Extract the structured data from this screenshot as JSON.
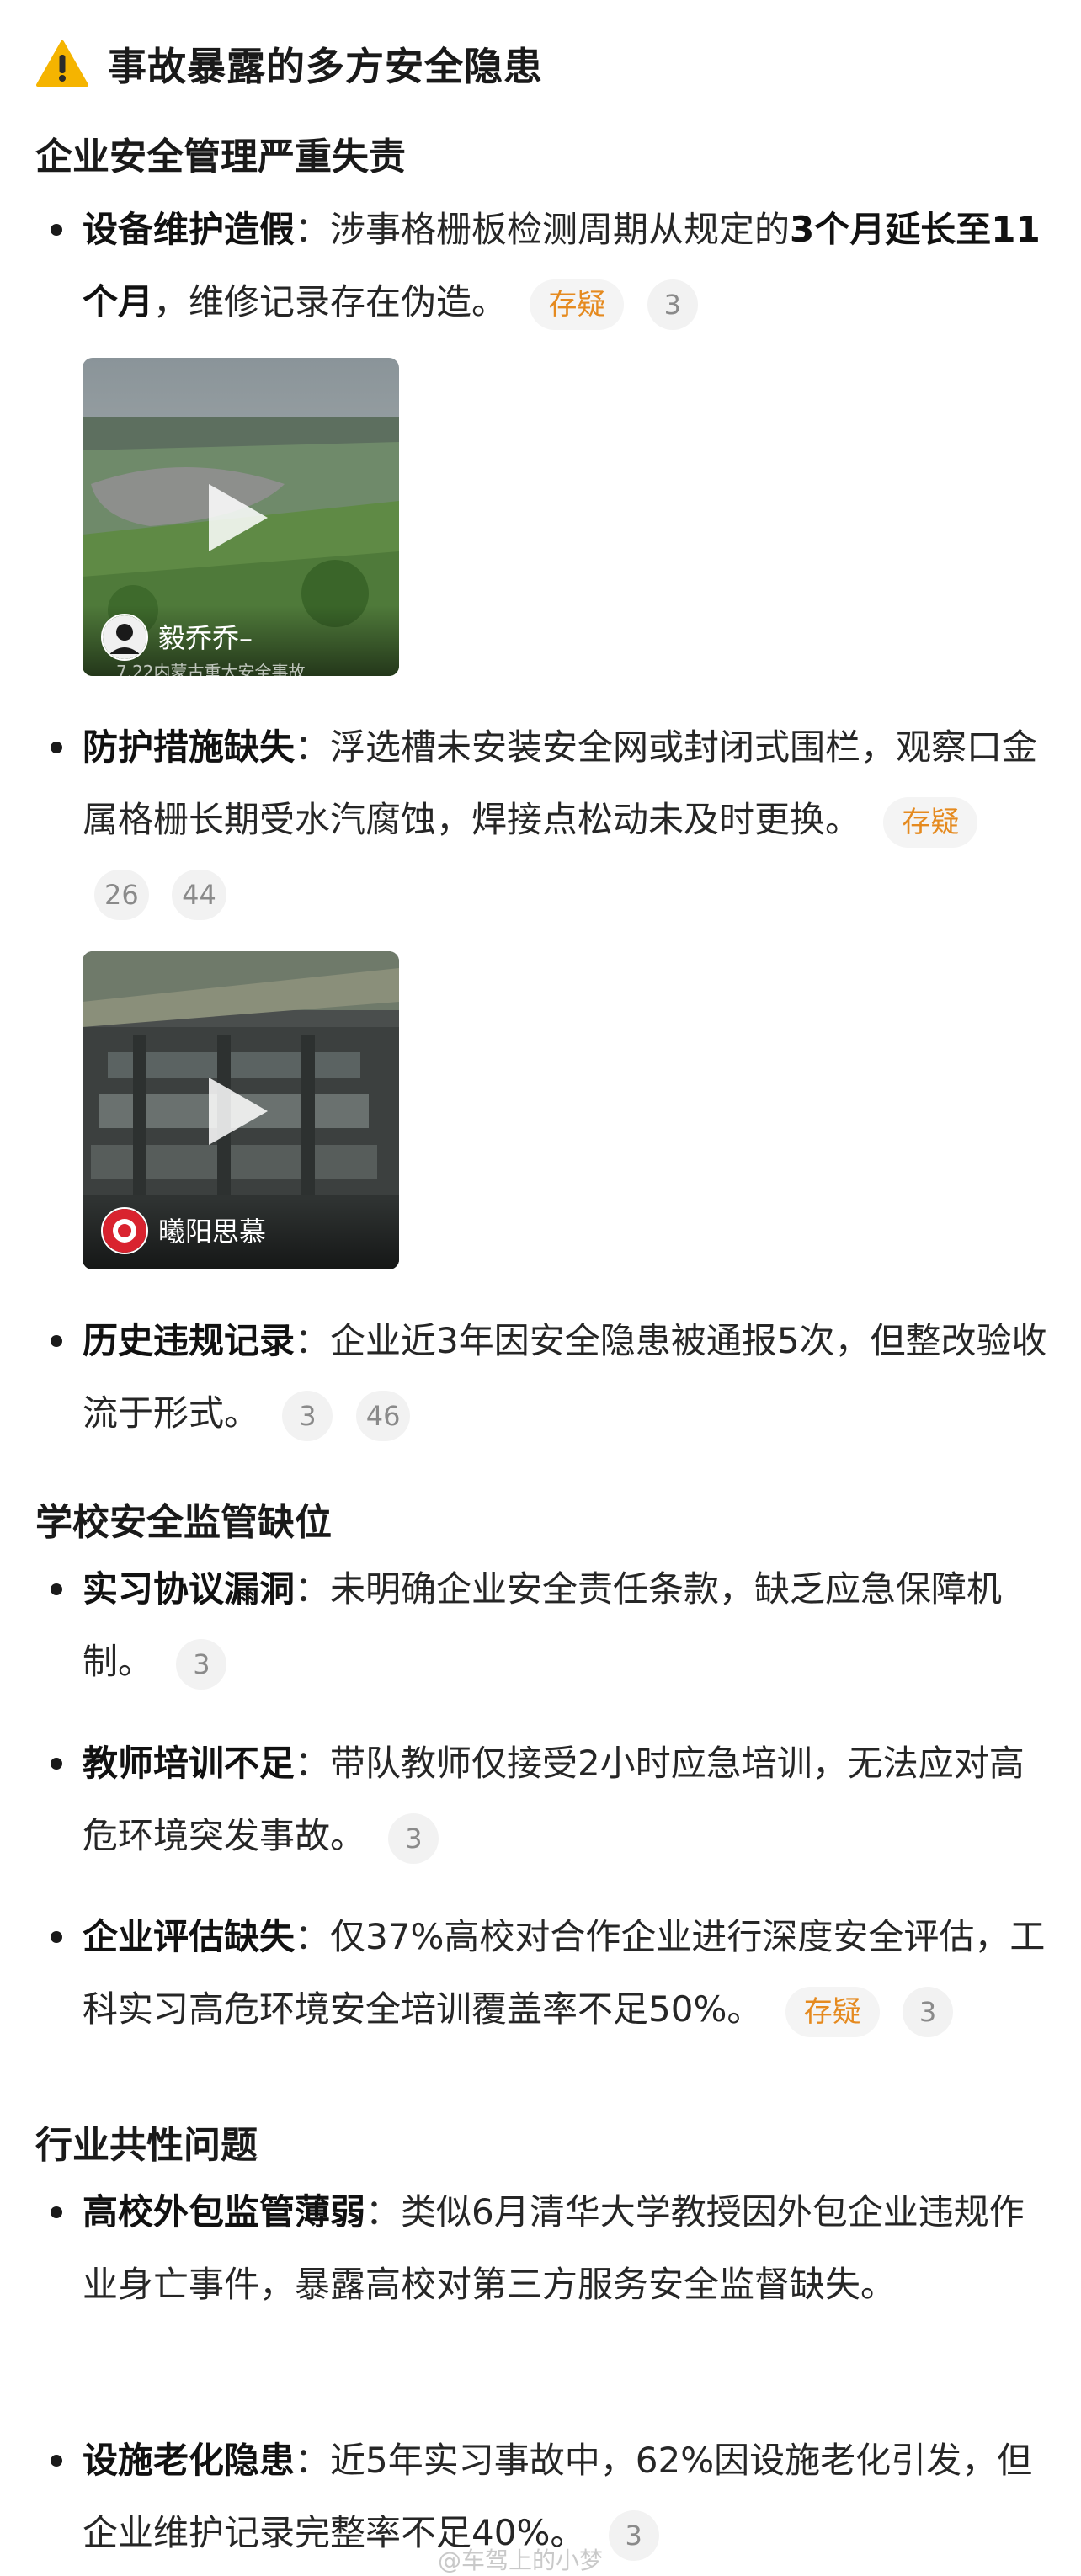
{
  "heading": {
    "icon": "warning-icon",
    "title": "事故暴露的多方安全隐患"
  },
  "sections": [
    {
      "title": "企业安全管理严重失责"
    },
    {
      "title": "学校安全监管缺位"
    },
    {
      "title": "行业共性问题"
    }
  ],
  "items": [
    {
      "label": "设备维护造假",
      "colon": "：",
      "text_a": "涉事格栅板检测周期从规定的",
      "bold_mid": "3个月延长至11个月",
      "text_b": "，维修记录存在伪造。",
      "tag": "存疑",
      "counts": [
        "3"
      ]
    },
    {
      "label": "防护措施缺失",
      "colon": "：",
      "text": "浮选槽未安装安全网或封闭式围栏，观察口金属格栅长期受水汽腐蚀，焊接点松动未及时更换。",
      "tag": "存疑",
      "counts": [
        "26",
        "44"
      ]
    },
    {
      "label": "历史违规记录",
      "colon": "：",
      "text": "企业近3年因安全隐患被通报5次，但整改验收流于形式。",
      "counts": [
        "3",
        "46"
      ]
    },
    {
      "label": "实习协议漏洞",
      "colon": "：",
      "text": "未明确企业安全责任条款，缺乏应急保障机制。",
      "counts": [
        "3"
      ]
    },
    {
      "label": "教师培训不足",
      "colon": "：",
      "text": "带队教师仅接受2小时应急培训，无法应对高危环境突发事故。",
      "counts": [
        "3"
      ]
    },
    {
      "label": "企业评估缺失",
      "colon": "：",
      "text": "仅37%高校对合作企业进行深度安全评估，工科实习高危环境安全培训覆盖率不足50%。",
      "tag": "存疑",
      "counts": [
        "3"
      ]
    },
    {
      "label": "高校外包监管薄弱",
      "colon": "：",
      "text": "类似6月清华大学教授因外包企业违规作业身亡事件，暴露高校对第三方服务安全监督缺失。"
    },
    {
      "label": "设施老化隐患",
      "colon": "：",
      "text": "近5年实习事故中，62%因设施老化引发，但企业维护记录完整率不足40%。",
      "counts": [
        "3"
      ]
    }
  ],
  "videos": [
    {
      "author": "毅乔乔–",
      "caption": "7.22内蒙古重大安全事故",
      "play_icon": "play-icon"
    },
    {
      "author": "曦阳思慕",
      "play_icon": "play-icon"
    }
  ],
  "watermark": "@车驾上的小梦"
}
